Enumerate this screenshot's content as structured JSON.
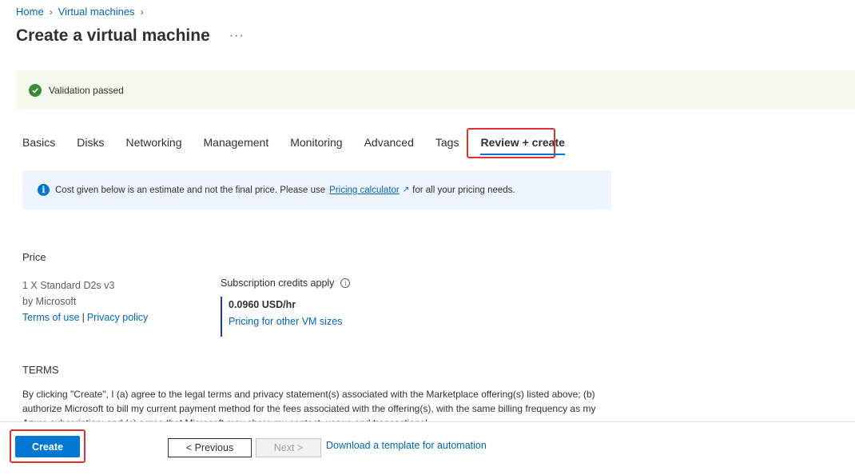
{
  "breadcrumb": {
    "items": [
      "Home",
      "Virtual machines"
    ]
  },
  "page": {
    "title": "Create a virtual machine",
    "more_label": "···"
  },
  "validation": {
    "message": "Validation passed",
    "status_color": "#3a8a3a"
  },
  "tabs": [
    {
      "label": "Basics",
      "active": false
    },
    {
      "label": "Disks",
      "active": false
    },
    {
      "label": "Networking",
      "active": false
    },
    {
      "label": "Management",
      "active": false
    },
    {
      "label": "Monitoring",
      "active": false
    },
    {
      "label": "Advanced",
      "active": false
    },
    {
      "label": "Tags",
      "active": false
    },
    {
      "label": "Review + create",
      "active": true
    }
  ],
  "info_banner": {
    "icon": "info-icon",
    "text_before": "Cost given below is an estimate and not the final price. Please use",
    "link": "Pricing calculator",
    "text_after": "for all your pricing needs."
  },
  "price": {
    "heading": "Price",
    "offering": "1 X Standard D2s v3",
    "publisher": "by Microsoft",
    "terms_link": "Terms of use",
    "separator": "|",
    "privacy_link": "Privacy policy",
    "credits_label": "Subscription credits apply",
    "amount": "0.0960 USD/hr",
    "other_sizes_link": "Pricing for other VM sizes"
  },
  "terms": {
    "heading": "TERMS",
    "text": "By clicking \"Create\", I (a) agree to the legal terms and privacy statement(s) associated with the Marketplace offering(s) listed above; (b) authorize Microsoft to bill my current payment method for the fees associated with the offering(s), with the same billing frequency as my Azure subscription; and (c) agree that Microsoft may share my contact, usage and transactional"
  },
  "footer": {
    "create_label": "Create",
    "previous_label": "< Previous",
    "next_label": "Next >",
    "download_link": "Download a template for automation"
  },
  "colors": {
    "accent": "#0078d4",
    "highlight": "#e03030",
    "validation_bg": "#f3f9ec",
    "info_bg": "#eef4fc"
  }
}
